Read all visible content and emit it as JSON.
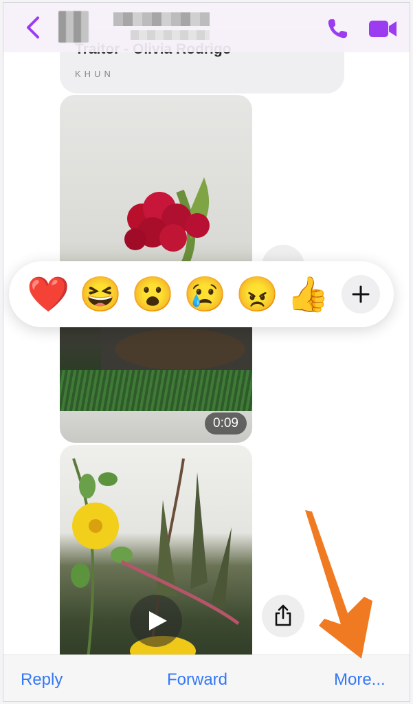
{
  "header": {
    "back_icon": "chevron-left-icon",
    "phone_icon": "phone-icon",
    "video_icon": "video-camera-icon",
    "accent": "#9b3cf0"
  },
  "music_card": {
    "title": "Traitor - Olivia Rodrigo",
    "artist": "KHUN"
  },
  "video1": {
    "duration": "0:09"
  },
  "reactions": {
    "items": [
      "❤️",
      "😆",
      "😮",
      "😢",
      "😠",
      "👍"
    ],
    "add_icon": "plus-icon"
  },
  "bottom_bar": {
    "reply_label": "Reply",
    "forward_label": "Forward",
    "more_label": "More...",
    "link_color": "#3478f6"
  },
  "annotation": {
    "arrow_color": "#f07a22"
  }
}
